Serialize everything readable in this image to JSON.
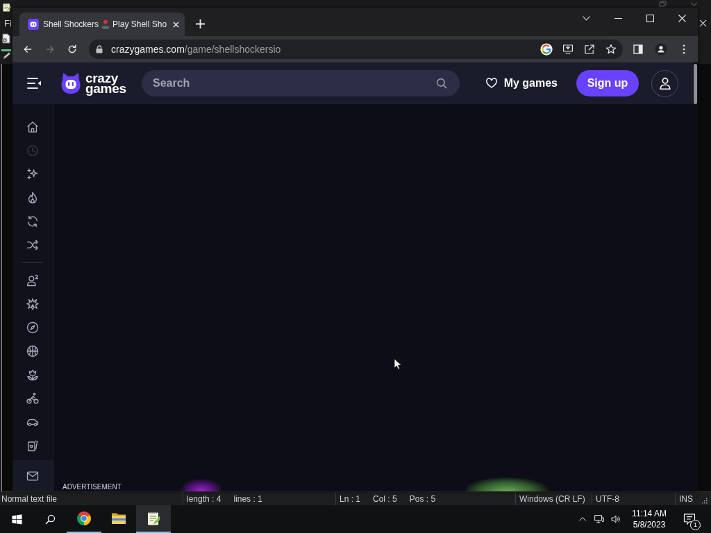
{
  "background_window": {
    "menu_text": "Fi"
  },
  "browser": {
    "tabs": [
      {
        "title": "Shell Shockers",
        "title_rest": "Play Shell Sho",
        "selected": true
      }
    ],
    "nav_buttons": [
      {
        "kind": "back",
        "disabled": false
      },
      {
        "kind": "forward",
        "disabled": true
      },
      {
        "kind": "reload",
        "disabled": false
      }
    ],
    "address": {
      "domain": "crazygames.com",
      "path": "/game/shellshockersio"
    }
  },
  "page": {
    "header": {
      "logo_text": "crazy games",
      "search": {
        "placeholder": "Search"
      },
      "my_games": "My games",
      "sign_up": "Sign up"
    },
    "sidebar": {
      "sections": [
        {
          "items": [
            {
              "kind": "home",
              "disabled": false
            },
            {
              "kind": "recent",
              "disabled": true
            },
            {
              "kind": "new",
              "disabled": false
            },
            {
              "kind": "hot",
              "disabled": false
            },
            {
              "kind": "updated",
              "disabled": false
            },
            {
              "kind": "random",
              "disabled": false
            }
          ]
        },
        {
          "items": [
            {
              "kind": "multiplayer",
              "disabled": false
            },
            {
              "kind": "action",
              "disabled": false
            },
            {
              "kind": "adventure",
              "disabled": false
            },
            {
              "kind": "ball",
              "disabled": false
            },
            {
              "kind": "flower",
              "disabled": false
            },
            {
              "kind": "bike",
              "disabled": false
            },
            {
              "kind": "car",
              "disabled": false
            },
            {
              "kind": "cards",
              "disabled": false
            }
          ]
        }
      ],
      "footer": [
        {
          "kind": "mail"
        }
      ]
    },
    "ad_label": "ADVERTISEMENT"
  },
  "status_bar": {
    "sections": [
      [
        "Normal text file"
      ],
      [
        "length : 4",
        "lines : 1"
      ],
      [
        "Ln : 1",
        "Col : 5",
        "Pos : 5"
      ],
      [
        "Windows (CR LF)"
      ],
      [
        "UTF-8"
      ],
      [
        "INS"
      ]
    ]
  },
  "taskbar": {
    "apps": [
      {
        "kind": "browser",
        "open": true,
        "selected": false
      },
      {
        "kind": "folder",
        "open": false,
        "selected": false
      },
      {
        "kind": "notepad",
        "open": true,
        "selected": true
      }
    ],
    "clock": {
      "time": "11:14 AM",
      "date": "5/8/2023"
    },
    "notifications": "1"
  }
}
